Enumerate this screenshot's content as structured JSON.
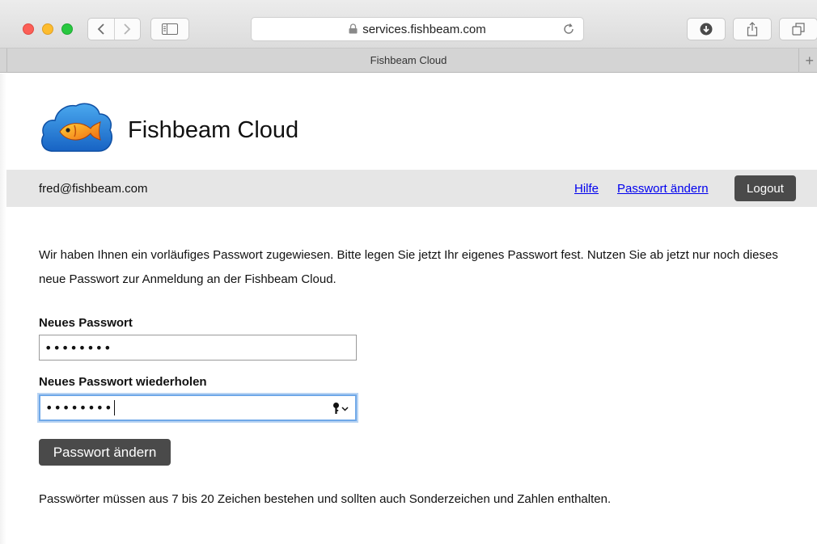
{
  "browser": {
    "url": "services.fishbeam.com",
    "tab_title": "Fishbeam Cloud",
    "icons": [
      "close-window",
      "minimize-window",
      "maximize-window",
      "back-icon",
      "forward-icon",
      "sidebar-icon",
      "lock-icon",
      "reload-icon",
      "download-icon",
      "share-icon",
      "tabs-icon",
      "new-tab-icon"
    ]
  },
  "site": {
    "title": "Fishbeam Cloud",
    "logo_icon": "fish-cloud-logo"
  },
  "userbar": {
    "email": "fred@fishbeam.com",
    "help_link": "Hilfe",
    "change_password_link": "Passwort ändern",
    "logout_label": "Logout"
  },
  "form": {
    "intro": "Wir haben Ihnen ein vorläufiges Passwort zugewiesen. Bitte legen Sie jetzt Ihr eigenes Passwort fest. Nutzen Sie ab jetzt nur noch dieses neue Passwort zur Anmeldung an der Fishbeam Cloud.",
    "new_password_label": "Neues Passwort",
    "new_password_value": "••••••••",
    "repeat_password_label": "Neues Passwort wiederholen",
    "repeat_password_value": "••••••••",
    "submit_label": "Passwort ändern",
    "hint": "Passwörter müssen aus 7 bis 20 Zeichen bestehen und sollten auch Sonderzeichen und Zahlen enthalten."
  },
  "colors": {
    "accent_link": "#0000ee",
    "button_bg": "#4a4a4a",
    "focus_ring": "#6fa8e8"
  }
}
